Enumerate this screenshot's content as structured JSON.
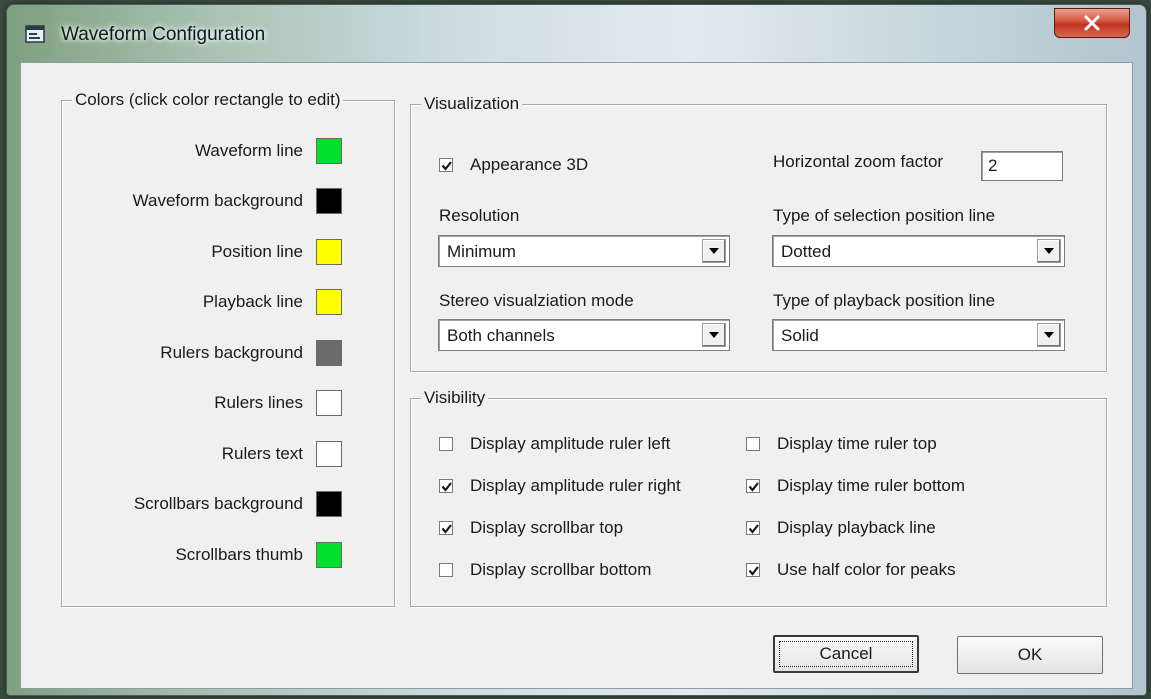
{
  "window": {
    "title": "Waveform Configuration"
  },
  "colors": {
    "legend": "Colors (click color rectangle to edit)",
    "items": [
      {
        "label": "Waveform line",
        "color": "#00e02a"
      },
      {
        "label": "Waveform background",
        "color": "#000000"
      },
      {
        "label": "Position line",
        "color": "#ffff00"
      },
      {
        "label": "Playback line",
        "color": "#ffff00"
      },
      {
        "label": "Rulers background",
        "color": "#6b6b6b"
      },
      {
        "label": "Rulers lines",
        "color": "#ffffff"
      },
      {
        "label": "Rulers text",
        "color": "#ffffff"
      },
      {
        "label": "Scrollbars background",
        "color": "#000000"
      },
      {
        "label": "Scrollbars thumb",
        "color": "#00e02a"
      }
    ]
  },
  "visualization": {
    "legend": "Visualization",
    "appearance_3d": {
      "label": "Appearance 3D",
      "checked": true
    },
    "zoom": {
      "label": "Horizontal zoom factor",
      "value": "2"
    },
    "resolution": {
      "label": "Resolution",
      "value": "Minimum"
    },
    "selection_line": {
      "label": "Type of selection position line",
      "value": "Dotted"
    },
    "stereo_mode": {
      "label": "Stereo visualziation mode",
      "value": "Both channels"
    },
    "playback_line": {
      "label": "Type of playback position line",
      "value": "Solid"
    }
  },
  "visibility": {
    "legend": "Visibility",
    "items": [
      {
        "label": "Display amplitude ruler left",
        "checked": false
      },
      {
        "label": "Display time ruler top",
        "checked": false
      },
      {
        "label": "Display amplitude ruler right",
        "checked": true
      },
      {
        "label": "Display time ruler bottom",
        "checked": true
      },
      {
        "label": "Display scrollbar top",
        "checked": true
      },
      {
        "label": "Display playback line",
        "checked": true
      },
      {
        "label": "Display scrollbar bottom",
        "checked": false
      },
      {
        "label": "Use half color for peaks",
        "checked": true
      }
    ]
  },
  "buttons": {
    "cancel": "Cancel",
    "ok": "OK"
  }
}
